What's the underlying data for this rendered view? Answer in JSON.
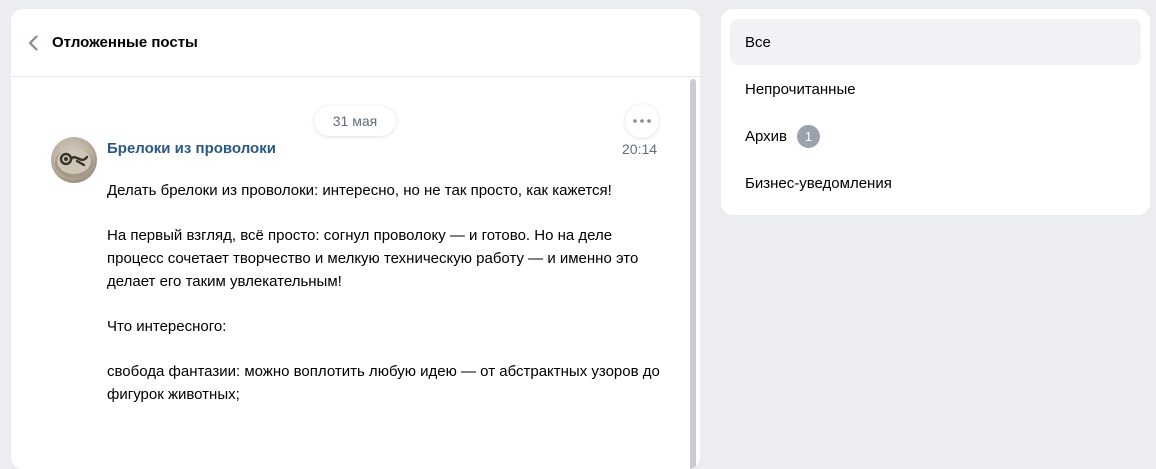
{
  "header": {
    "title": "Отложенные посты",
    "back_icon": "chevron-left-icon"
  },
  "feed": {
    "date_label": "31 мая",
    "post": {
      "author": "Брелоки из проволоки",
      "time": "20:14",
      "paragraphs": [
        "Делать брелоки из проволоки: интересно, но не так просто, как кажется!",
        "На первый взгляд, всё просто: согнул проволоку — и готово. Но на деле процесс сочетает творчество и мелкую техническую работу — и именно это делает его таким увлекательным!",
        "Что интересного:",
        "свобода фантазии: можно воплотить любую идею — от абстрактных узоров до фигурок животных;"
      ]
    }
  },
  "sidebar": {
    "items": [
      {
        "label": "Все",
        "active": true
      },
      {
        "label": "Непрочитанные"
      },
      {
        "label": "Архив",
        "badge": "1"
      },
      {
        "label": "Бизнес-уведомления"
      }
    ]
  },
  "colors": {
    "link": "#2a5885",
    "secondary_text": "#626d7a",
    "badge_bg": "#99a2ad",
    "page_bg": "#ebedf0"
  }
}
